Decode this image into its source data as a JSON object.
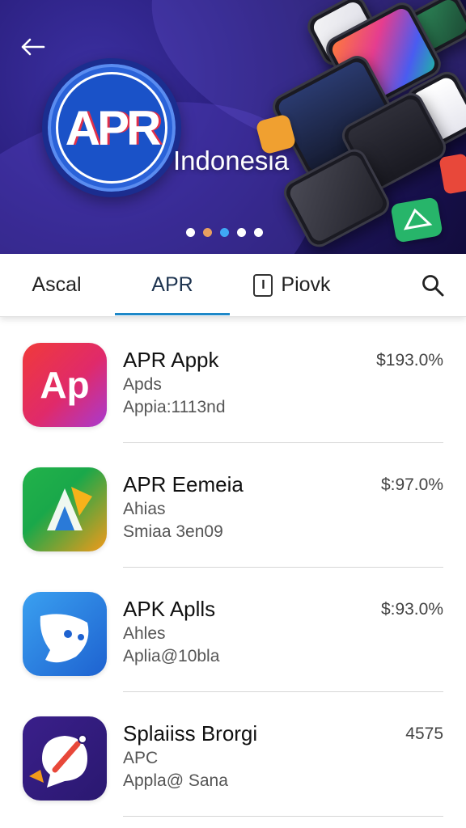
{
  "hero": {
    "logo_text": "APR",
    "title": "Indonesia",
    "dots_count": 5,
    "active_dot": 3
  },
  "tabs": [
    {
      "label": "Ascal",
      "active": false
    },
    {
      "label": "APR",
      "active": true
    },
    {
      "label": "Piovk",
      "icon_text": "I",
      "active": false
    }
  ],
  "apps": [
    {
      "name": "APR Appk",
      "sub1": "Apds",
      "sub2": "Appia:1113nd",
      "price": "$193.0%",
      "icon_text": "Ap"
    },
    {
      "name": "APR Eemeia",
      "sub1": "Ahias",
      "sub2": "Smiaa 3en09",
      "price": "$:97.0%",
      "icon_text": ""
    },
    {
      "name": "APK Aplls",
      "sub1": "Ahles",
      "sub2": "Aplia@10bla",
      "price": "$:93.0%",
      "icon_text": ""
    },
    {
      "name": "Splaiiss Brorgi",
      "sub1": "APC",
      "sub2": "Appla@ Sana",
      "price": "4575",
      "icon_text": ""
    }
  ],
  "colors": {
    "accent": "#1e88c8",
    "hero_bg": "#2a1f7e"
  }
}
